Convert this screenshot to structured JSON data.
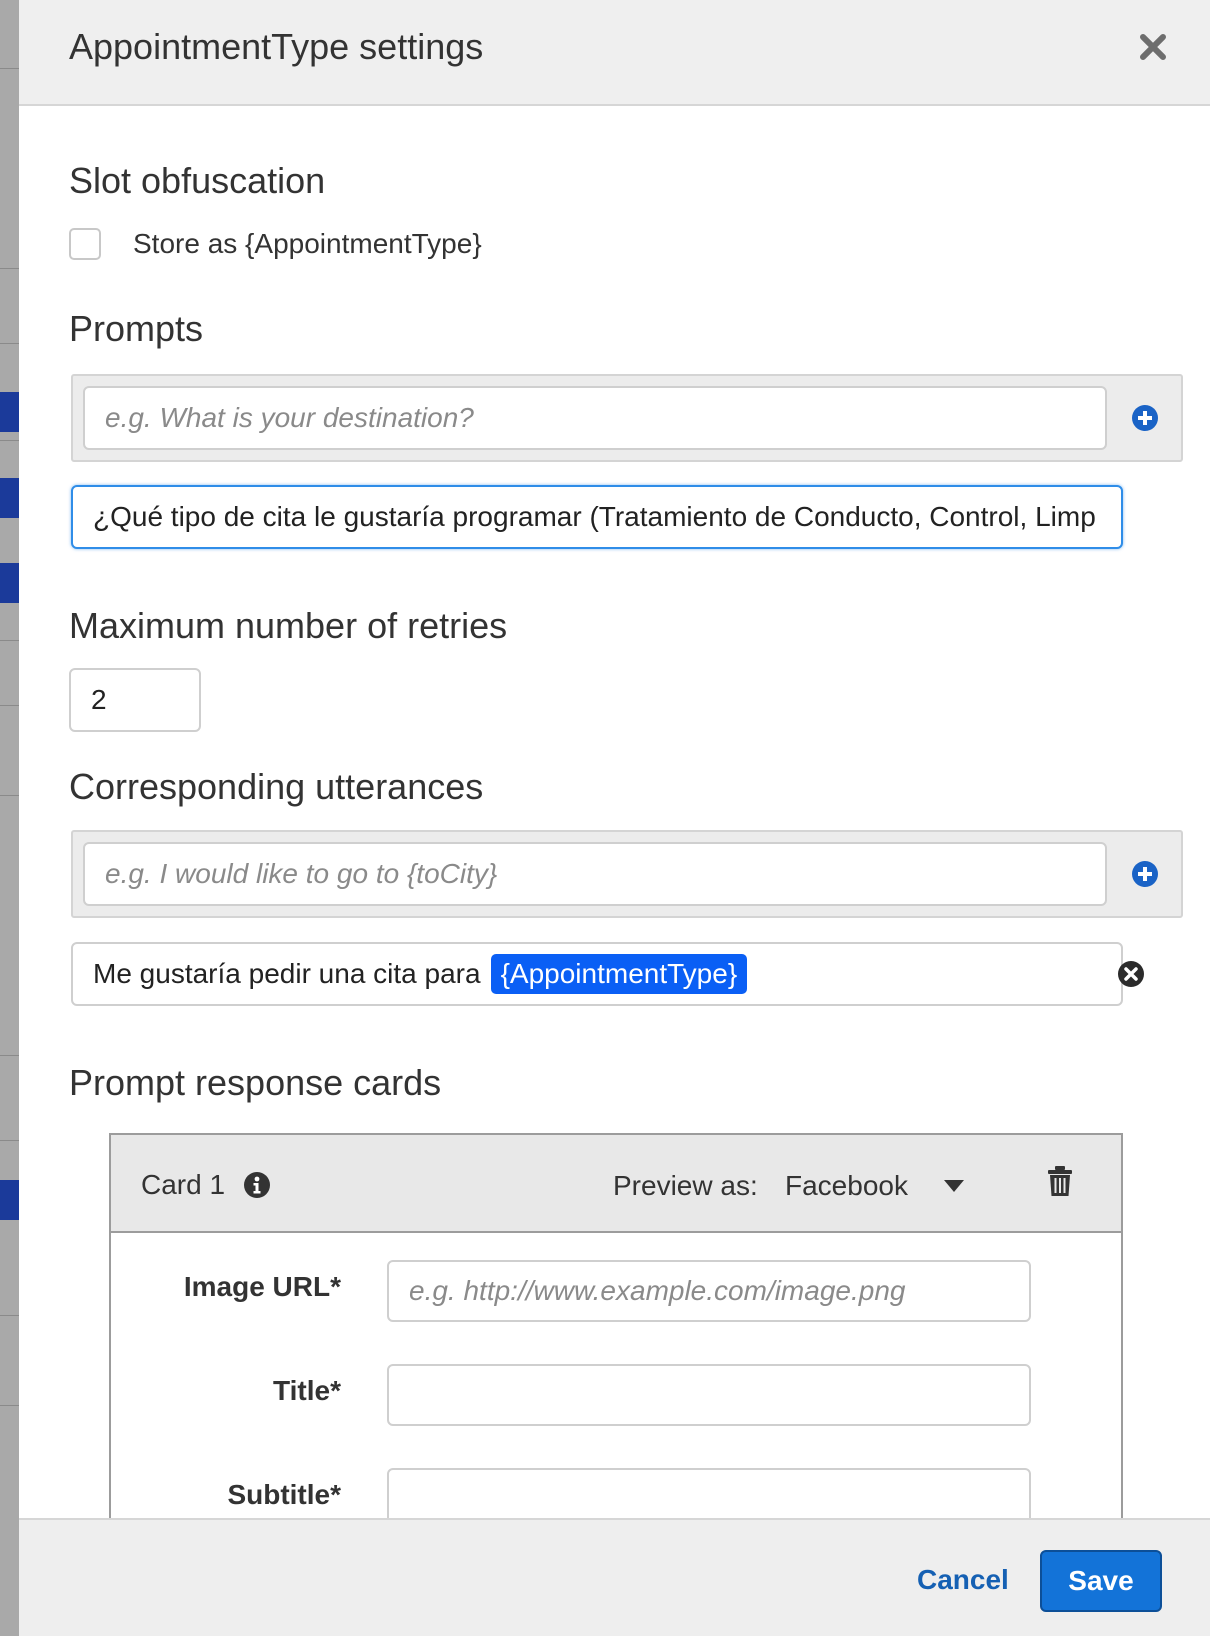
{
  "modal": {
    "title": "AppointmentType settings"
  },
  "slot_obfuscation": {
    "heading": "Slot obfuscation",
    "checkbox_label": "Store as {AppointmentType}",
    "checked": false
  },
  "prompts": {
    "heading": "Prompts",
    "new_prompt_placeholder": "e.g. What is your destination?",
    "items": [
      "¿Qué tipo de cita le gustaría programar (Tratamiento de Conducto, Control, Limp"
    ]
  },
  "retries": {
    "heading": "Maximum number of retries",
    "value": "2"
  },
  "utterances": {
    "heading": "Corresponding utterances",
    "new_utterance_placeholder": "e.g. I would like to go to {toCity}",
    "items": [
      {
        "text": "Me gustaría pedir una cita para",
        "slot": "{AppointmentType}"
      }
    ]
  },
  "response_cards": {
    "heading": "Prompt response cards",
    "card": {
      "name": "Card 1",
      "preview_label": "Preview as:",
      "preview_value": "Facebook",
      "fields": {
        "image_url_label": "Image URL*",
        "image_url_placeholder": "e.g. http://www.example.com/image.png",
        "title_label": "Title*",
        "subtitle_label": "Subtitle*"
      }
    }
  },
  "footer": {
    "cancel_label": "Cancel",
    "save_label": "Save"
  },
  "colors": {
    "accent": "#1373d8",
    "slot_tag": "#0a5ff5",
    "focus_border": "#2f8de8"
  },
  "icons": [
    "close-icon",
    "plus-circle-icon",
    "x-circle-icon",
    "info-icon",
    "caret-down-icon",
    "trash-icon"
  ]
}
